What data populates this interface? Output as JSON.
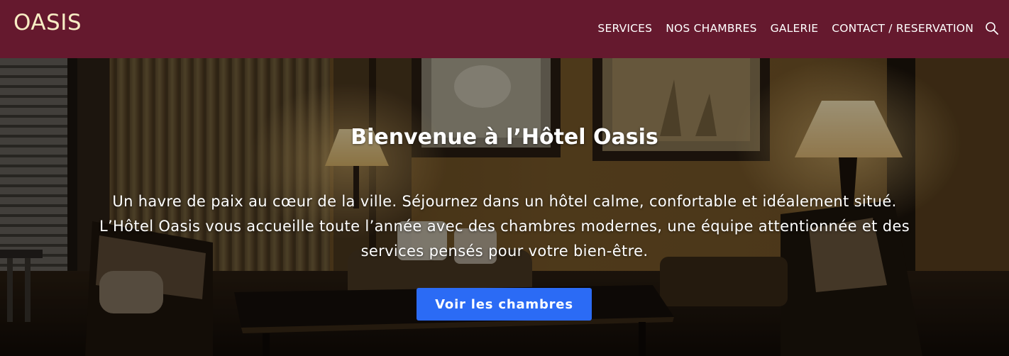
{
  "header": {
    "logo": "OASIS",
    "nav": [
      {
        "label": "SERVICES"
      },
      {
        "label": "NOS CHAMBRES"
      },
      {
        "label": "GALERIE"
      },
      {
        "label": "CONTACT / RESERVATION"
      }
    ],
    "search_icon": "search-icon",
    "background_color": "#65192e",
    "logo_color": "#f7edc4"
  },
  "hero": {
    "title": "Bienvenue à l’Hôtel Oasis",
    "text_lines": [
      "Un havre de paix au cœur de la ville. Séjournez dans un hôtel calme, confortable et idéalement situé.",
      "L’Hôtel Oasis vous accueille toute l’année avec des chambres modernes, une équipe attentionnée et des",
      "services pensés pour votre bien-être."
    ],
    "button_label": "Voir les chambres",
    "button_color": "#2b6bf5"
  }
}
